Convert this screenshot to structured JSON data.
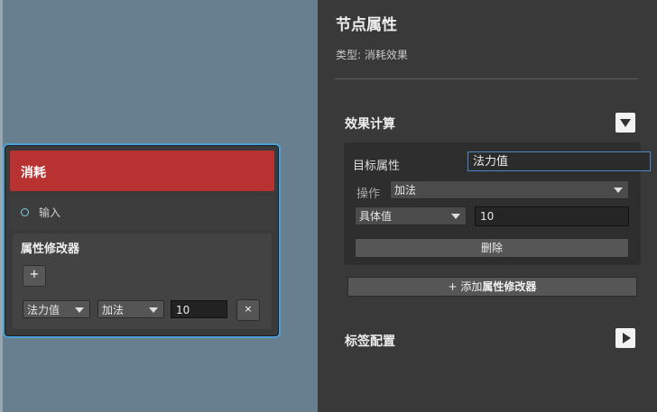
{
  "node": {
    "title": "消耗",
    "input_port": "输入",
    "modifier": {
      "title": "属性修改器",
      "add_label": "+",
      "attribute": "法力值",
      "operation": "加法",
      "value": "10",
      "remove_label": "×"
    }
  },
  "panel": {
    "title": "节点属性",
    "type_text": "类型: 消耗效果",
    "effect_section": {
      "title": "效果计算",
      "target_label": "目标属性",
      "target_value": "法力值",
      "operation_label": "操作",
      "operation_value": "加法",
      "value_type": "具体值",
      "value": "10",
      "delete_label": "删除"
    },
    "add_modifier_prefix": "+ 添加",
    "add_modifier_bold": "属性修改器",
    "tag_section": {
      "title": "标签配置"
    }
  }
}
